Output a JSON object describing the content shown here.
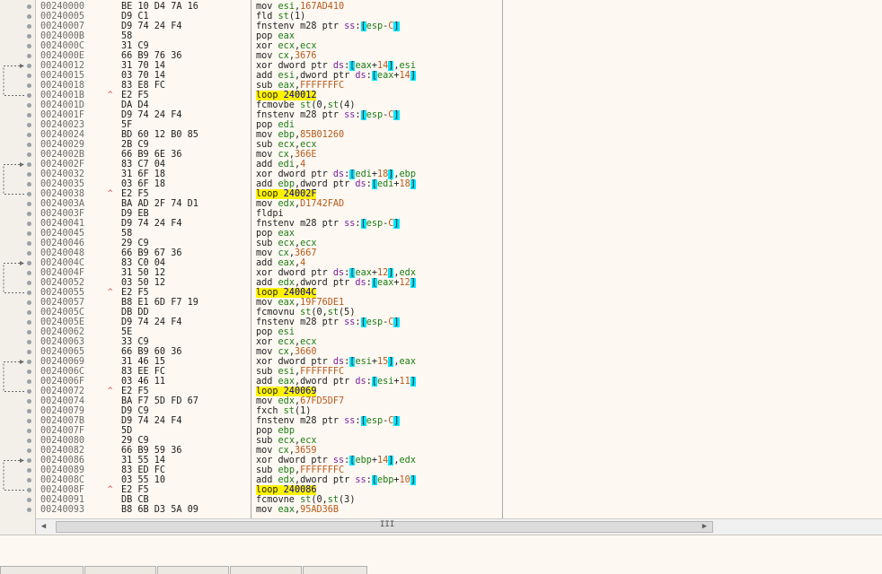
{
  "window": {
    "scroll_thumb_label": "III"
  },
  "rows": [
    {
      "addr": "00240000",
      "bytes": "BE 10 D4 7A 16",
      "text": "mov esi,167AD410"
    },
    {
      "addr": "00240005",
      "bytes": "D9 C1",
      "text": "fld st(1)"
    },
    {
      "addr": "00240007",
      "bytes": "D9 74 24 F4",
      "text": "fnstenv m28 ptr ss:[esp-C]"
    },
    {
      "addr": "0024000B",
      "bytes": "58",
      "text": "pop eax"
    },
    {
      "addr": "0024000C",
      "bytes": "31 C9",
      "text": "xor ecx,ecx"
    },
    {
      "addr": "0024000E",
      "bytes": "66 B9 76 36",
      "text": "mov cx,3676"
    },
    {
      "addr": "00240012",
      "bytes": "31 70 14",
      "text": "xor dword ptr ds:[eax+14],esi"
    },
    {
      "addr": "00240015",
      "bytes": "03 70 14",
      "text": "add esi,dword ptr ds:[eax+14]"
    },
    {
      "addr": "00240018",
      "bytes": "83 E8 FC",
      "text": "sub eax,FFFFFFFC"
    },
    {
      "addr": "0024001B",
      "bytes": "E2 F5",
      "text": "loop 240012",
      "loop": true
    },
    {
      "addr": "0024001D",
      "bytes": "DA D4",
      "text": "fcmovbe st(0,st(4)"
    },
    {
      "addr": "0024001F",
      "bytes": "D9 74 24 F4",
      "text": "fnstenv m28 ptr ss:[esp-C]"
    },
    {
      "addr": "00240023",
      "bytes": "5F",
      "text": "pop edi"
    },
    {
      "addr": "00240024",
      "bytes": "BD 60 12 B0 85",
      "text": "mov ebp,85B01260"
    },
    {
      "addr": "00240029",
      "bytes": "2B C9",
      "text": "sub ecx,ecx"
    },
    {
      "addr": "0024002B",
      "bytes": "66 B9 6E 36",
      "text": "mov cx,366E"
    },
    {
      "addr": "0024002F",
      "bytes": "83 C7 04",
      "text": "add edi,4"
    },
    {
      "addr": "00240032",
      "bytes": "31 6F 18",
      "text": "xor dword ptr ds:[edi+18],ebp"
    },
    {
      "addr": "00240035",
      "bytes": "03 6F 18",
      "text": "add ebp,dword ptr ds:[edi+18]"
    },
    {
      "addr": "00240038",
      "bytes": "E2 F5",
      "text": "loop 24002F",
      "loop": true
    },
    {
      "addr": "0024003A",
      "bytes": "BA AD 2F 74 D1",
      "text": "mov edx,D1742FAD"
    },
    {
      "addr": "0024003F",
      "bytes": "D9 EB",
      "text": "fldpi"
    },
    {
      "addr": "00240041",
      "bytes": "D9 74 24 F4",
      "text": "fnstenv m28 ptr ss:[esp-C]"
    },
    {
      "addr": "00240045",
      "bytes": "58",
      "text": "pop eax"
    },
    {
      "addr": "00240046",
      "bytes": "29 C9",
      "text": "sub ecx,ecx"
    },
    {
      "addr": "00240048",
      "bytes": "66 B9 67 36",
      "text": "mov cx,3667"
    },
    {
      "addr": "0024004C",
      "bytes": "83 C0 04",
      "text": "add eax,4"
    },
    {
      "addr": "0024004F",
      "bytes": "31 50 12",
      "text": "xor dword ptr ds:[eax+12],edx"
    },
    {
      "addr": "00240052",
      "bytes": "03 50 12",
      "text": "add edx,dword ptr ds:[eax+12]"
    },
    {
      "addr": "00240055",
      "bytes": "E2 F5",
      "text": "loop 24004C",
      "loop": true
    },
    {
      "addr": "00240057",
      "bytes": "B8 E1 6D F7 19",
      "text": "mov eax,19F76DE1"
    },
    {
      "addr": "0024005C",
      "bytes": "DB DD",
      "text": "fcmovnu st(0,st(5)"
    },
    {
      "addr": "0024005E",
      "bytes": "D9 74 24 F4",
      "text": "fnstenv m28 ptr ss:[esp-C]"
    },
    {
      "addr": "00240062",
      "bytes": "5E",
      "text": "pop esi"
    },
    {
      "addr": "00240063",
      "bytes": "33 C9",
      "text": "xor ecx,ecx"
    },
    {
      "addr": "00240065",
      "bytes": "66 B9 60 36",
      "text": "mov cx,3660"
    },
    {
      "addr": "00240069",
      "bytes": "31 46 15",
      "text": "xor dword ptr ds:[esi+15],eax"
    },
    {
      "addr": "0024006C",
      "bytes": "83 EE FC",
      "text": "sub esi,FFFFFFFC"
    },
    {
      "addr": "0024006F",
      "bytes": "03 46 11",
      "text": "add eax,dword ptr ds:[esi+11]"
    },
    {
      "addr": "00240072",
      "bytes": "E2 F5",
      "text": "loop 240069",
      "loop": true
    },
    {
      "addr": "00240074",
      "bytes": "BA F7 5D FD 67",
      "text": "mov edx,67FD5DF7"
    },
    {
      "addr": "00240079",
      "bytes": "D9 C9",
      "text": "fxch st(1)"
    },
    {
      "addr": "0024007B",
      "bytes": "D9 74 24 F4",
      "text": "fnstenv m28 ptr ss:[esp-C]"
    },
    {
      "addr": "0024007F",
      "bytes": "5D",
      "text": "pop ebp"
    },
    {
      "addr": "00240080",
      "bytes": "29 C9",
      "text": "sub ecx,ecx"
    },
    {
      "addr": "00240082",
      "bytes": "66 B9 59 36",
      "text": "mov cx,3659"
    },
    {
      "addr": "00240086",
      "bytes": "31 55 14",
      "text": "xor dword ptr ss:[ebp+14],edx"
    },
    {
      "addr": "00240089",
      "bytes": "83 ED FC",
      "text": "sub ebp,FFFFFFFC"
    },
    {
      "addr": "0024008C",
      "bytes": "03 55 10",
      "text": "add edx,dword ptr ss:[ebp+10]"
    },
    {
      "addr": "0024008F",
      "bytes": "E2 F5",
      "text": "loop 240086",
      "loop": true
    },
    {
      "addr": "00240091",
      "bytes": "DB CB",
      "text": "fcmovne st(0,st(3)"
    },
    {
      "addr": "00240093",
      "bytes": "B8 6B D3 5A 09",
      "text": "mov eax,95AD36B"
    }
  ],
  "jumps": [
    {
      "from": 9,
      "to": 6
    },
    {
      "from": 19,
      "to": 16
    },
    {
      "from": 29,
      "to": 26
    },
    {
      "from": 39,
      "to": 36
    },
    {
      "from": 49,
      "to": 46
    }
  ],
  "colors": {
    "loop_highlight": "#fff200",
    "bracket_highlight": "#00e5ff",
    "gutter_line": "#6b6b6b"
  }
}
